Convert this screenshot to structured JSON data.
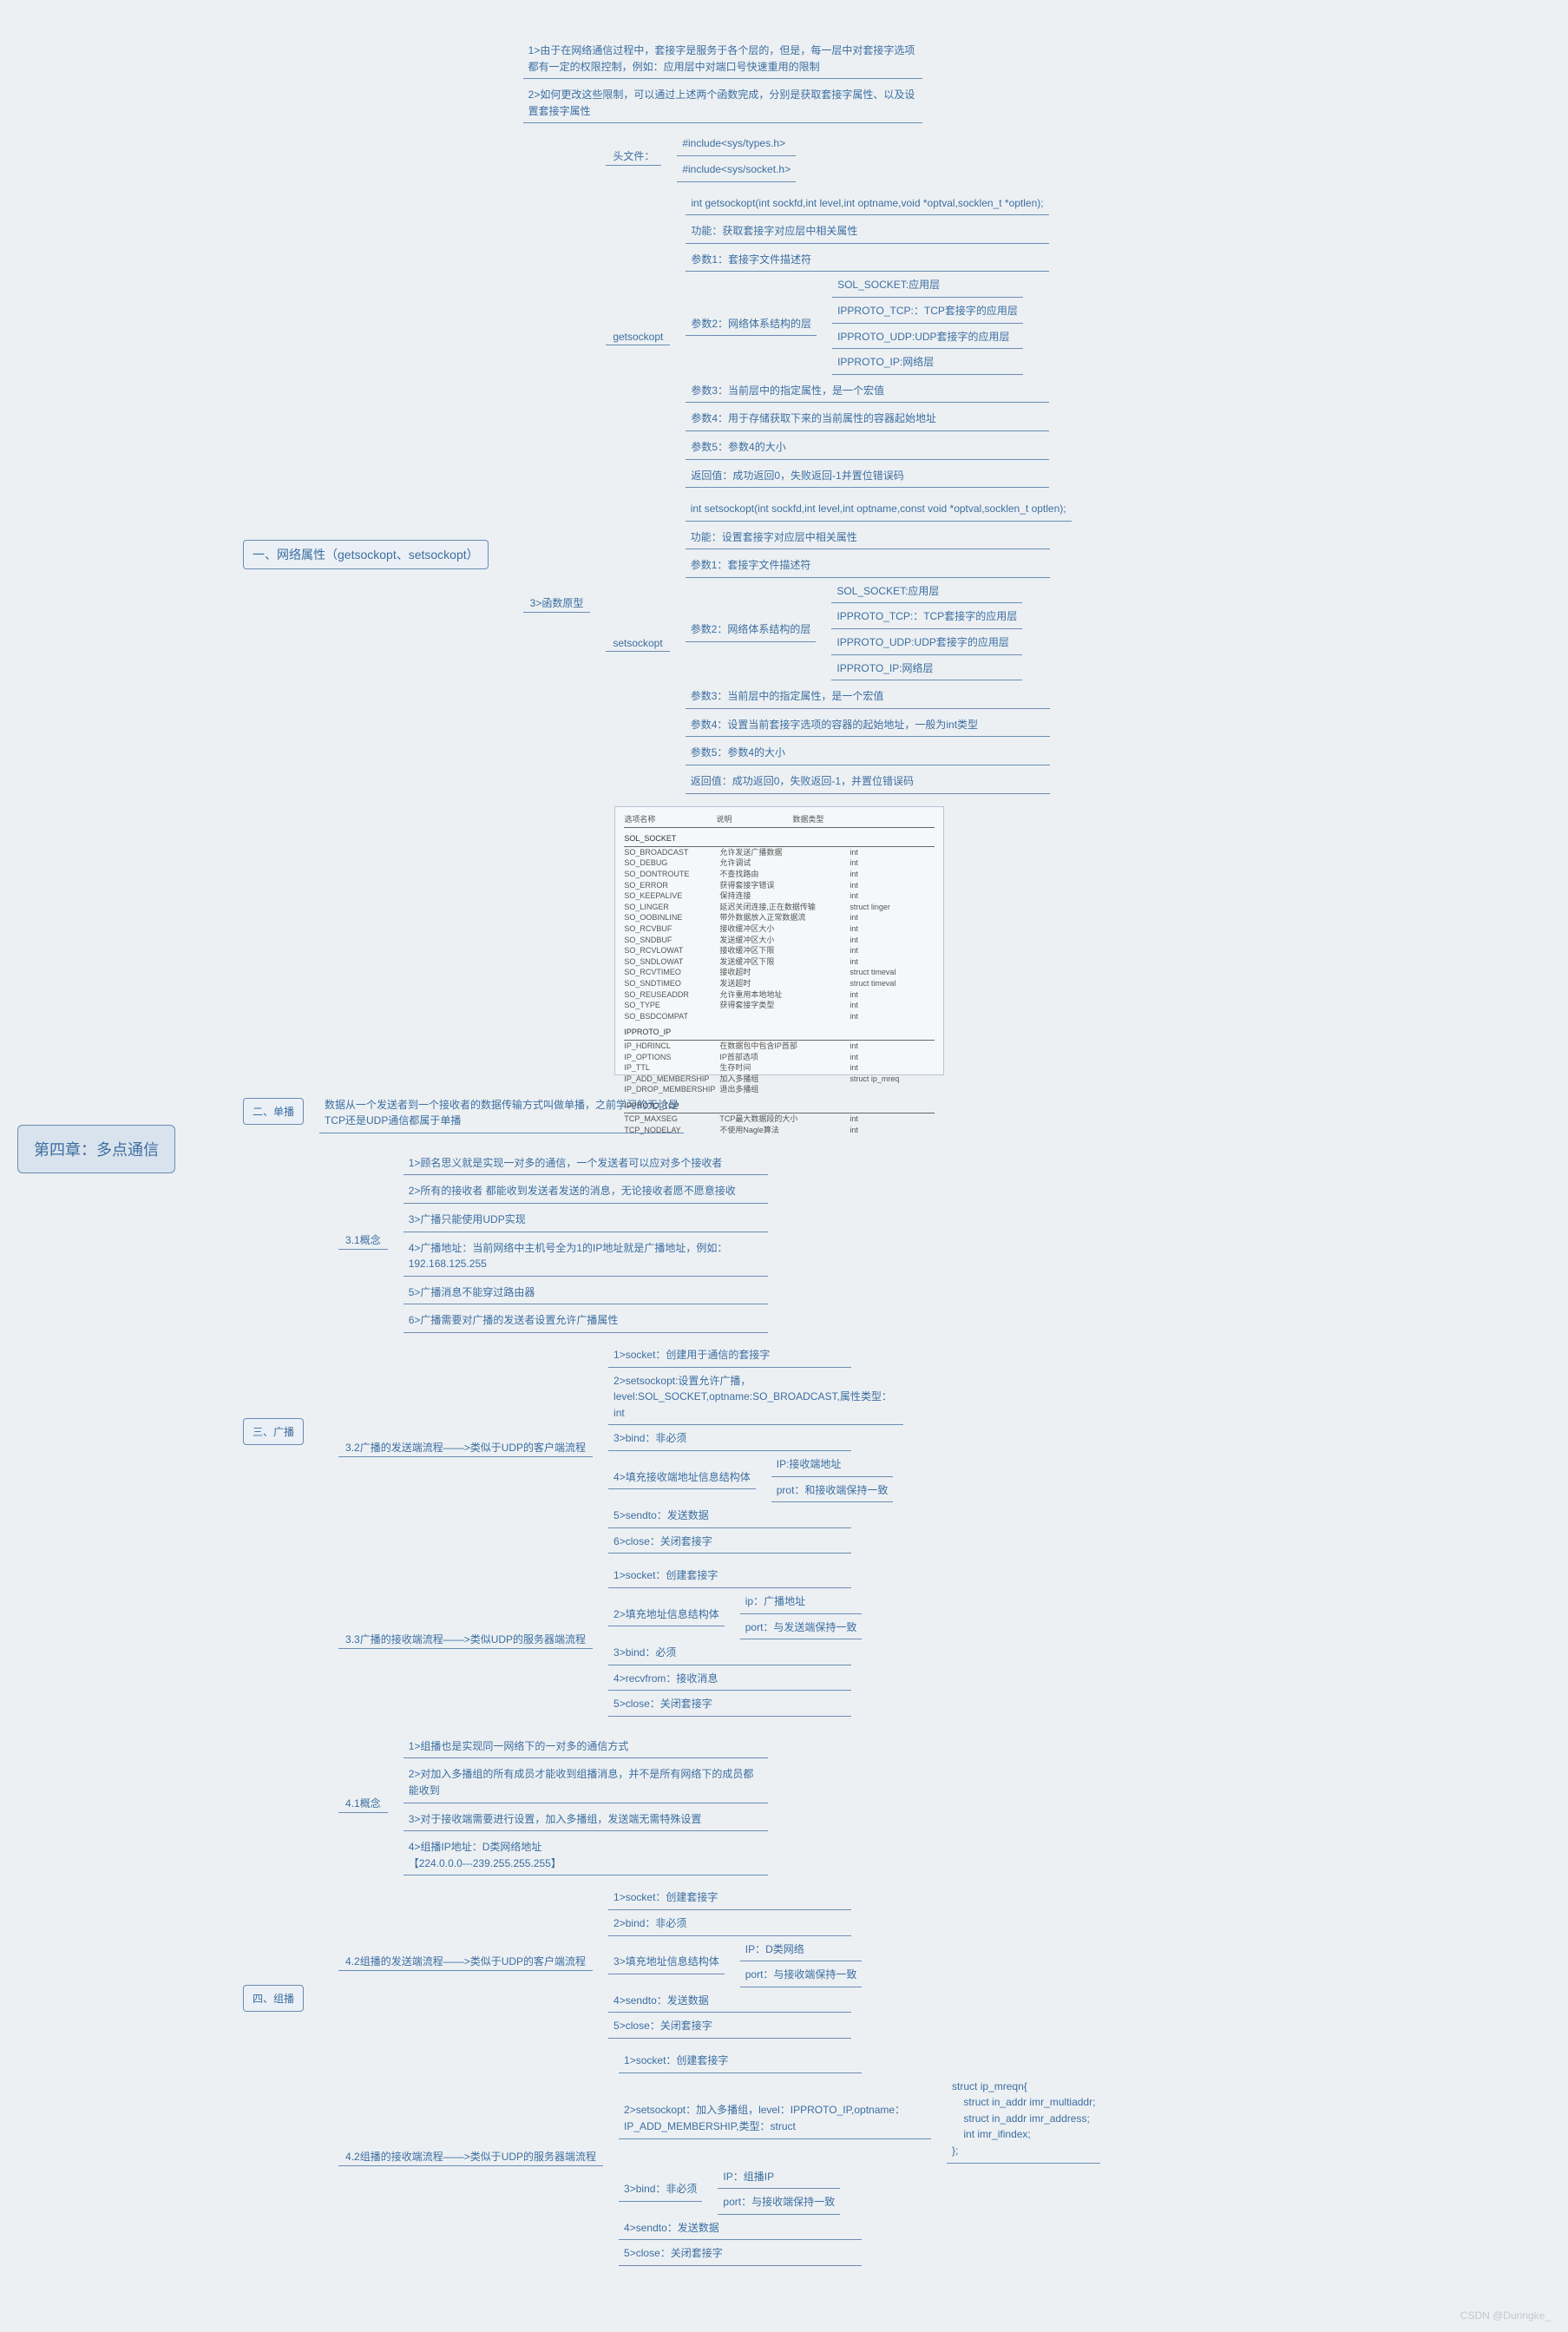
{
  "root": "第四章：多点通信",
  "sections": {
    "s1": {
      "title": "一、网络属性（getsockopt、setsockopt）",
      "notes": {
        "n1": "1>由于在网络通信过程中，套接字是服务于各个层的，但是，每一层中对套接字选项都有一定的权限控制，例如：应用层中对端口号快速重用的限制",
        "n2": "2>如何更改这些限制，可以通过上述两个函数完成，分别是获取套接字属性、以及设置套接字属性",
        "n3": "3>函数原型"
      },
      "head": {
        "label": "头文件：",
        "files": [
          "#include<sys/types.h>",
          "#include<sys/socket.h>"
        ]
      },
      "getsockopt": {
        "label": "getsockopt",
        "sig": "int getsockopt(int sockfd,int level,int optname,void *optval,socklen_t *optlen);",
        "f": "功能：获取套接字对应层中相关属性",
        "p1": "参数1：套接字文件描述符",
        "p2_label": "参数2：网络体系结构的层",
        "p2_opts": [
          "SOL_SOCKET:应用层",
          "IPPROTO_TCP:：TCP套接字的应用层",
          "IPPROTO_UDP:UDP套接字的应用层",
          "IPPROTO_IP:网络层"
        ],
        "p3": "参数3：当前层中的指定属性，是一个宏值",
        "p4": "参数4：用于存储获取下来的当前属性的容器起始地址",
        "p5": "参数5：参数4的大小",
        "ret": "返回值：成功返回0，失败返回-1并置位错误码"
      },
      "setsockopt": {
        "label": "setsockopt",
        "sig": "int setsockopt(int sockfd,int level,int optname,const void *optval,socklen_t optlen);",
        "f": "功能：设置套接字对应层中相关属性",
        "p1": "参数1：套接字文件描述符",
        "p2_label": "参数2：网络体系结构的层",
        "p2_opts": [
          "SOL_SOCKET:应用层",
          "IPPROTO_TCP:：TCP套接字的应用层",
          "IPPROTO_UDP:UDP套接字的应用层",
          "IPPROTO_IP:网络层"
        ],
        "p3": "参数3：当前层中的指定属性，是一个宏值",
        "p4": "参数4：设置当前套接字选项的容器的起始地址，一般为int类型",
        "p5": "参数5：参数4的大小",
        "ret": "返回值：成功返回0，失败返回-1，并置位错误码"
      },
      "table": {
        "headers": [
          "选项名称",
          "说明",
          "数据类型"
        ],
        "groups": [
          {
            "name": "SOL_SOCKET",
            "rows": [
              [
                "SO_BROADCAST",
                "允许发送广播数据",
                "int"
              ],
              [
                "SO_DEBUG",
                "允许调试",
                "int"
              ],
              [
                "SO_DONTROUTE",
                "不查找路由",
                "int"
              ],
              [
                "SO_ERROR",
                "获得套接字错误",
                "int"
              ],
              [
                "SO_KEEPALIVE",
                "保持连接",
                "int"
              ],
              [
                "SO_LINGER",
                "延迟关闭连接,正在数据传输",
                "struct linger"
              ],
              [
                "SO_OOBINLINE",
                "带外数据放入正常数据流",
                "int"
              ],
              [
                "SO_RCVBUF",
                "接收缓冲区大小",
                "int"
              ],
              [
                "SO_SNDBUF",
                "发送缓冲区大小",
                "int"
              ],
              [
                "SO_RCVLOWAT",
                "接收缓冲区下限",
                "int"
              ],
              [
                "SO_SNDLOWAT",
                "发送缓冲区下限",
                "int"
              ],
              [
                "SO_RCVTIMEO",
                "接收超时",
                "struct timeval"
              ],
              [
                "SO_SNDTIMEO",
                "发送超时",
                "struct timeval"
              ],
              [
                "SO_REUSEADDR",
                "允许重用本地地址",
                "int"
              ],
              [
                "SO_TYPE",
                "获得套接字类型",
                "int"
              ],
              [
                "SO_BSDCOMPAT",
                "",
                "int"
              ]
            ]
          },
          {
            "name": "IPPROTO_IP",
            "rows": [
              [
                "IP_HDRINCL",
                "在数据包中包含IP首部",
                "int"
              ],
              [
                "IP_OPTIONS",
                "IP首部选项",
                "int"
              ],
              [
                "IP_TTL",
                "生存时间",
                "int"
              ],
              [
                "IP_ADD_MEMBERSHIP",
                "加入多播组",
                "struct ip_mreq"
              ],
              [
                "IP_DROP_MEMBERSHIP",
                "退出多播组",
                ""
              ]
            ]
          },
          {
            "name": "IPPROTO_TCP",
            "rows": [
              [
                "TCP_MAXSEG",
                "TCP最大数据段的大小",
                "int"
              ],
              [
                "TCP_NODELAY",
                "不使用Nagle算法",
                "int"
              ]
            ]
          }
        ]
      }
    },
    "s2": {
      "title": "二、单播",
      "note": "数据从一个发送者到一个接收者的数据传输方式叫做单播，之前学习的无论是TCP还是UDP通信都属于单播"
    },
    "s3": {
      "title": "三、广播",
      "c31": {
        "label": "3.1概念",
        "items": [
          "1>顾名思义就是实现一对多的通信，一个发送者可以应对多个接收者",
          "2>所有的接收者 都能收到发送者发送的消息，无论接收者愿不愿意接收",
          "3>广播只能使用UDP实现",
          "4>广播地址：当前网络中主机号全为1的IP地址就是广播地址，例如：192.168.125.255",
          "5>广播消息不能穿过路由器",
          "6>广播需要对广播的发送者设置允许广播属性"
        ]
      },
      "c32": {
        "label": "3.2广播的发送端流程——>类似于UDP的客户端流程",
        "items": [
          "1>socket：创建用于通信的套接字",
          "2>setsockopt:设置允许广播，level:SOL_SOCKET,optname:SO_BROADCAST,属性类型：int",
          "3>bind：非必须",
          "4>填充接收端地址信息结构体",
          "5>sendto：发送数据",
          "6>close：关闭套接字"
        ],
        "sub4": [
          "IP:接收端地址",
          "prot：和接收端保持一致"
        ]
      },
      "c33": {
        "label": "3.3广播的接收端流程——>类似UDP的服务器端流程",
        "items": [
          "1>socket：创建套接字",
          "2>填充地址信息结构体",
          "3>bind：必须",
          "4>recvfrom：接收消息",
          "5>close：关闭套接字"
        ],
        "sub2": [
          "ip：广播地址",
          "port：与发送端保持一致"
        ]
      }
    },
    "s4": {
      "title": "四、组播",
      "c41": {
        "label": "4.1概念",
        "items": [
          "1>组播也是实现同一网络下的一对多的通信方式",
          "2>对加入多播组的所有成员才能收到组播消息，并不是所有网络下的成员都能收到",
          "3>对于接收端需要进行设置，加入多播组，发送端无需特殊设置",
          "4>组播IP地址：D类网络地址\n【224.0.0.0---239.255.255.255】"
        ]
      },
      "c42": {
        "label": "4.2组播的发送端流程——>类似于UDP的客户端流程",
        "items": [
          "1>socket：创建套接字",
          "2>bind：非必须",
          "3>填充地址信息结构体",
          "4>sendto：发送数据",
          "5>close：关闭套接字"
        ],
        "sub3": [
          "IP：D类网络",
          "port：与接收端保持一致"
        ]
      },
      "c43": {
        "label": "4.2组播的接收端流程——>类似于UDP的服务器端流程",
        "items": [
          "1>socket：创建套接字",
          "2>setsockopt：加入多播组，level：IPPROTO_IP,optname：IP_ADD_MEMBERSHIP,类型：struct",
          "3>bind：非必须",
          "4>sendto：发送数据",
          "5>close：关闭套接字"
        ],
        "sub2": "struct ip_mreqn{\n    struct in_addr imr_multiaddr;\n    struct in_addr imr_address;\n    int imr_ifindex;\n};",
        "sub3": [
          "IP：组播IP",
          "port：与接收端保持一致"
        ]
      }
    }
  },
  "watermark": "CSDN @Duringke_"
}
